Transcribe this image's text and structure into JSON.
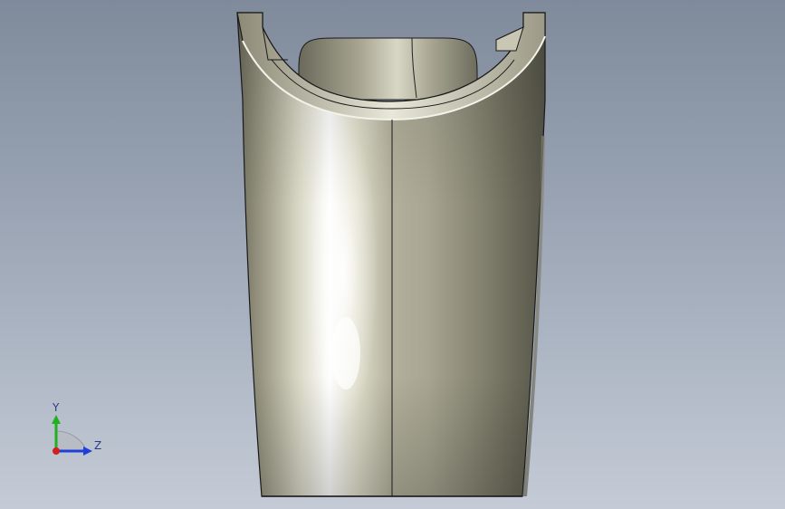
{
  "viewport": {
    "background_top": "#7f8a9b",
    "background_bottom": "#c4cbd6"
  },
  "model": {
    "name_icon": "cylindrical-shell-part-icon",
    "surface_color": "#c9c6b0",
    "edge_color": "#1a1a1a"
  },
  "triad": {
    "y_label": "Y",
    "z_label": "Z",
    "y_color": "#22b022",
    "z_color": "#1f3fd8",
    "x_color": "#d02020"
  }
}
